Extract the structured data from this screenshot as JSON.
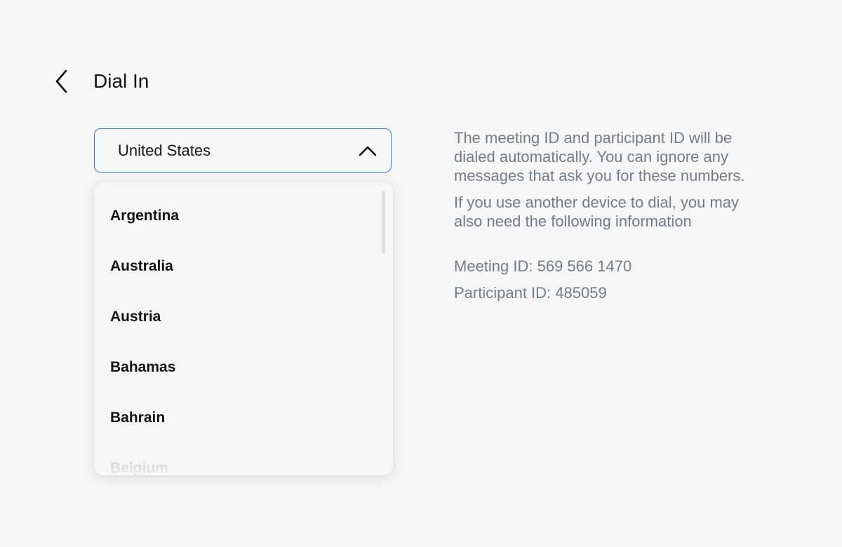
{
  "header": {
    "back_icon": "chevron-left-icon",
    "title": "Dial In"
  },
  "country_select": {
    "selected_value": "United States",
    "chevron_icon": "chevron-up-icon",
    "accent_color": "#2f7ad6",
    "options": [
      "Argentina",
      "Australia",
      "Austria",
      "Bahamas",
      "Bahrain",
      "Belgium"
    ]
  },
  "info": {
    "paragraph_1": "The meeting ID and participant ID will be dialed automatically. You can ignore any messages that ask you for these numbers.",
    "paragraph_2": "If you use another device to dial, you may also need the following information",
    "meeting_id": "Meeting ID: 569 566 1470",
    "participant_id": "Participant ID: 485059",
    "text_color": "#747c86"
  }
}
